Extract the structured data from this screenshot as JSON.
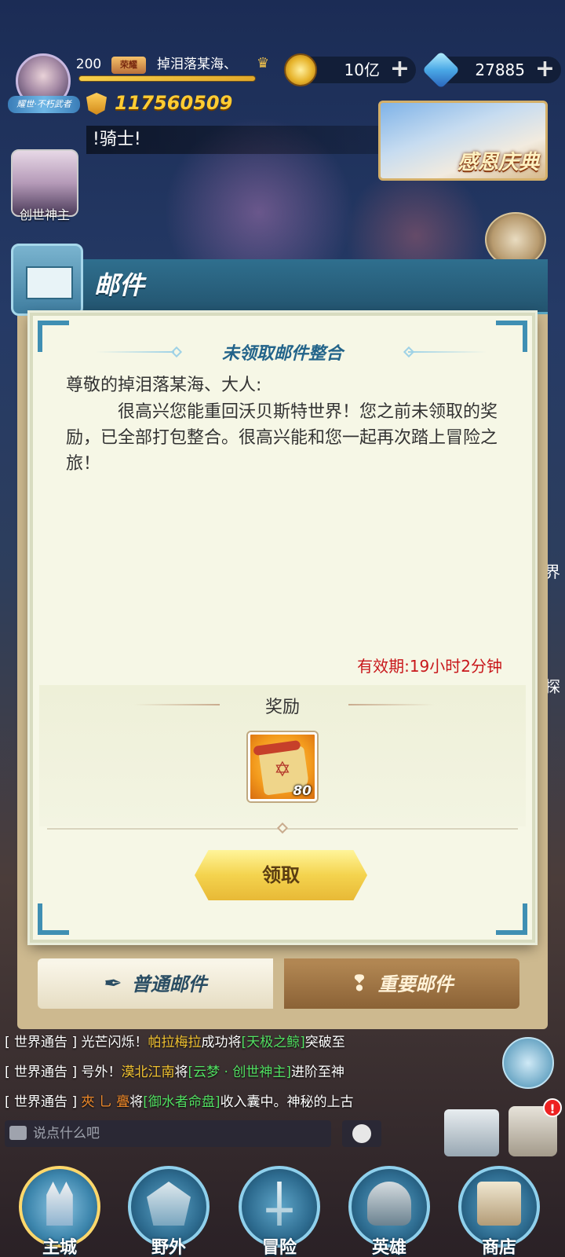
{
  "hud": {
    "player_title": "耀世·不朽武者",
    "level": "200",
    "vip_label": "荣耀",
    "player_name": "掉泪落某海、",
    "gold_value": "10亿",
    "gem_value": "27885",
    "plus_symbol": "+",
    "power_value": "117560509",
    "marquee_text": "!骑士!",
    "event_label": "感恩庆典",
    "hero_name": "创世神主",
    "side_tag_1": "界",
    "side_tag_2": "探"
  },
  "mail": {
    "header_title": "邮件",
    "dialog": {
      "title": "未领取邮件整合",
      "greeting": "尊敬的掉泪落某海、大人:",
      "body": "很高兴您能重回沃贝斯特世界！您之前未领取的奖励，已全部打包整合。很高兴能和您一起再次踏上冒险之旅！",
      "expire": "有效期:19小时2分钟",
      "reward_title": "奖励",
      "reward_item_qty": "80",
      "claim_label": "领取"
    },
    "tabs": {
      "normal": "普通邮件",
      "important": "重要邮件"
    }
  },
  "chat": {
    "lines": [
      {
        "tag": "[ 世界通告 ]",
        "p1": " 光芒闪烁！",
        "h1": "帕拉梅拉",
        "p2": "成功将",
        "h2": "[天极之鲸]",
        "p3": "突破至"
      },
      {
        "tag": "[ 世界通告 ]",
        "p1": " 号外！",
        "h1": "漠北江南",
        "p2": "将",
        "h2": "[云梦 · 创世神主]",
        "p3": "进阶至神"
      },
      {
        "tag": "[ 世界通告 ]",
        "p1": " ",
        "h1": "夾 乚 亹",
        "p2": "将",
        "h2": "[御水者命盘]",
        "p3": "收入囊中。神秘的上古"
      }
    ],
    "input_placeholder": "说点什么吧",
    "badge": "!"
  },
  "nav": {
    "items": [
      "主城",
      "野外",
      "冒险",
      "英雄",
      "商店"
    ]
  },
  "colors": {
    "accent_blue": "#23648a",
    "expire_red": "#c8171b",
    "claim_yellow": "#f4d34e",
    "power_gold": "#ffcc33"
  }
}
